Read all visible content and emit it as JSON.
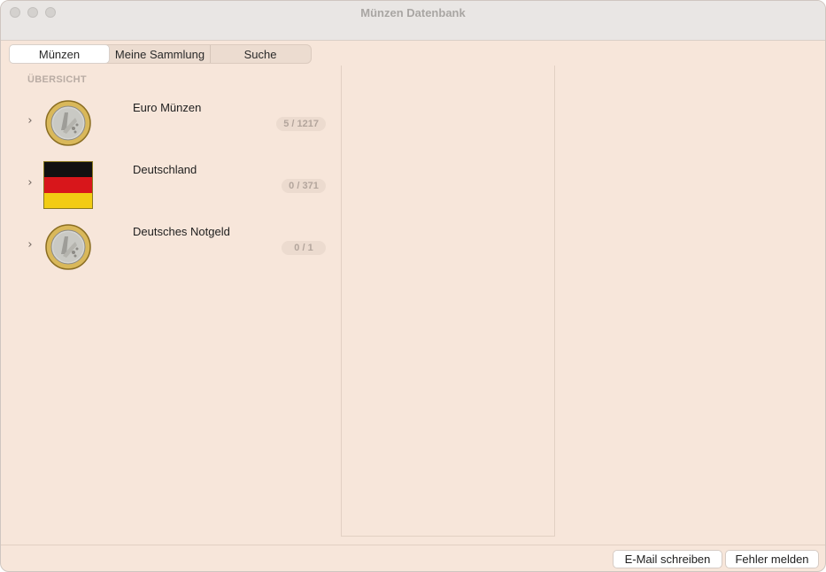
{
  "window": {
    "title": "Münzen Datenbank"
  },
  "tabs": [
    {
      "label": "Münzen",
      "selected": true
    },
    {
      "label": "Meine Sammlung",
      "selected": false
    },
    {
      "label": "Suche",
      "selected": false
    }
  ],
  "sidebar": {
    "section_header": "ÜBERSICHT",
    "items": [
      {
        "label": "Euro Münzen",
        "count": "5 / 1217",
        "icon": "euro-coin-icon"
      },
      {
        "label": "Deutschland",
        "count": "0 / 371",
        "icon": "germany-flag-icon"
      },
      {
        "label": "Deutsches Notgeld",
        "count": "0 / 1",
        "icon": "euro-coin-icon"
      }
    ]
  },
  "footer": {
    "email_button": "E-Mail schreiben",
    "bug_button": "Fehler melden"
  },
  "colors": {
    "window_bg": "#f7e6da",
    "titlebar_bg": "#e9e6e4",
    "badge_bg": "#ecdbcf",
    "flag_black": "#111111",
    "flag_red": "#d8161b",
    "flag_gold": "#f2cc13"
  }
}
